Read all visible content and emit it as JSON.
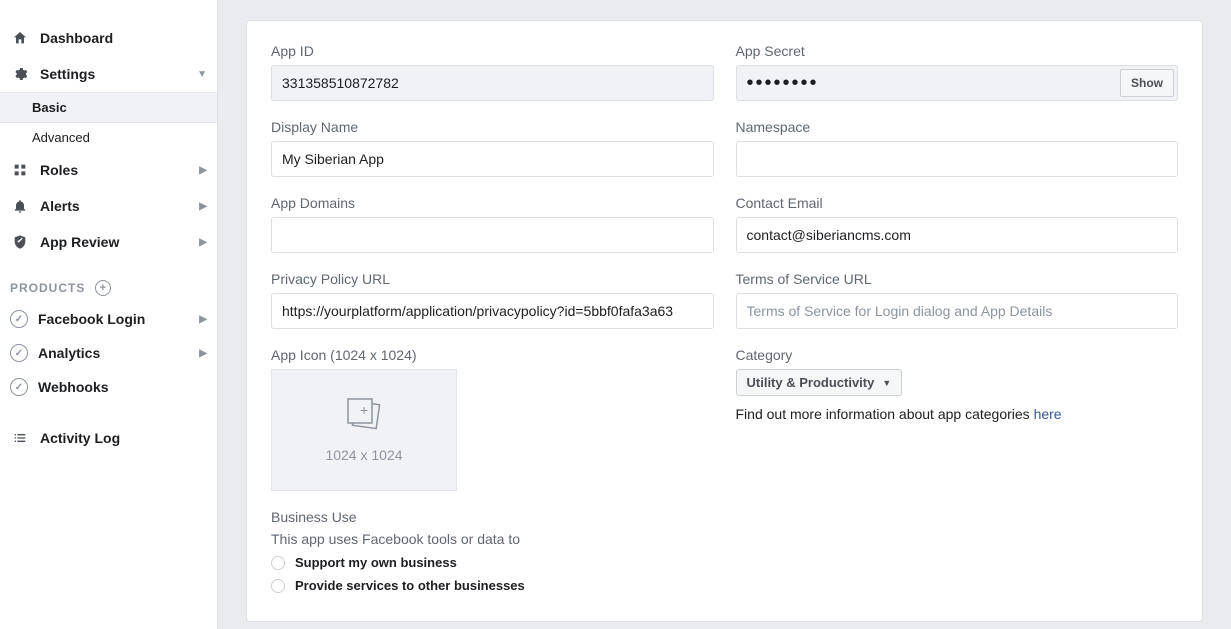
{
  "sidebar": {
    "dashboard": "Dashboard",
    "settings": "Settings",
    "settings_sub": {
      "basic": "Basic",
      "advanced": "Advanced"
    },
    "roles": "Roles",
    "alerts": "Alerts",
    "app_review": "App Review",
    "products_header": "PRODUCTS",
    "products": {
      "facebook_login": "Facebook Login",
      "analytics": "Analytics",
      "webhooks": "Webhooks"
    },
    "activity_log": "Activity Log"
  },
  "form": {
    "app_id_label": "App ID",
    "app_id_value": "331358510872782",
    "app_secret_label": "App Secret",
    "app_secret_value": "••••••••",
    "show_btn": "Show",
    "display_name_label": "Display Name",
    "display_name_value": "My Siberian App",
    "namespace_label": "Namespace",
    "namespace_value": "",
    "app_domains_label": "App Domains",
    "app_domains_value": "",
    "contact_email_label": "Contact Email",
    "contact_email_value": "contact@siberiancms.com",
    "privacy_label": "Privacy Policy URL",
    "privacy_value": "https://yourplatform/application/privacypolicy?id=5bbf0fafa3a63",
    "tos_label": "Terms of Service URL",
    "tos_placeholder": "Terms of Service for Login dialog and App Details",
    "app_icon_label": "App Icon (1024 x 1024)",
    "app_icon_size": "1024 x 1024",
    "category_label": "Category",
    "category_value": "Utility & Productivity",
    "category_info": "Find out more information about app categories ",
    "category_link": "here",
    "business_use_label": "Business Use",
    "business_use_desc": "This app uses Facebook tools or data to",
    "business_opt1": "Support my own business",
    "business_opt2": "Provide services to other businesses"
  }
}
